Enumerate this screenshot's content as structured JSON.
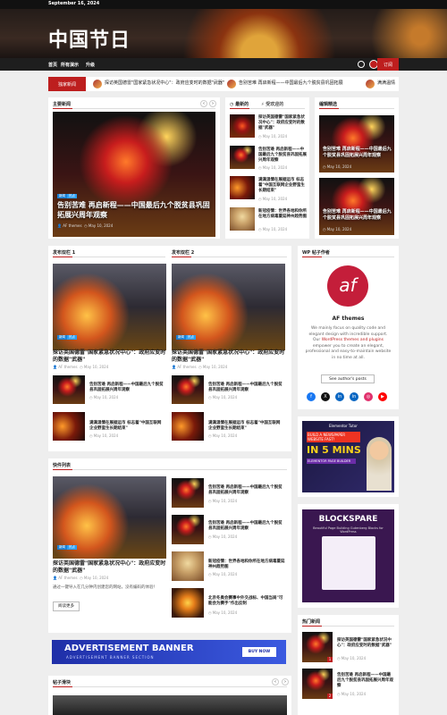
{
  "topbar": {
    "date": "September 16, 2024"
  },
  "site": {
    "title": "中国节日"
  },
  "nav": {
    "items": [
      "首页",
      "所有演示",
      "升级"
    ],
    "subscribe": "订阅"
  },
  "ticker": {
    "label": "独家新闻",
    "items": [
      "探访英国德雷\"国家紧急状况中心\"：政府应变时的数据\"武器\"",
      "告别苦难 再启新程——中国最后九个脱贫县巩固拓展",
      "满满温情"
    ]
  },
  "main_news": {
    "heading": "主要新闻",
    "featured": {
      "tags": [
        "新闻",
        "热点"
      ],
      "title": "告别苦难 再启新程——中国最后九个脱贫县巩固拓展兴周年观察",
      "author": "AF themes",
      "date": "May 10, 2024"
    }
  },
  "tabs_panel": {
    "tabs": [
      "最新的",
      "受欢迎的"
    ],
    "items": [
      {
        "title": "探访英国德雷\"国家紧急状况中心\"：政府应变时的数据\"武器\"",
        "date": "May 10, 2024"
      },
      {
        "title": "告别苦难 再启新程——中国最后九个脱贫县巩固拓展兴周年观察",
        "date": "May 10, 2024"
      },
      {
        "title": "满满温情在展据运市 标志着\"中国互联网企业野蛮生长期结束\"",
        "date": "May 10, 2024"
      },
      {
        "title": "新冠疫情：世界各地和你所在地方病毒蔓延神州趋势图",
        "date": "May 10, 2024"
      }
    ]
  },
  "editors_pick": {
    "heading": "编辑精选",
    "items": [
      {
        "title": "告别苦难 再启新程——中国最后九个脱贫县巩固拓展兴周年观察",
        "date": "May 10, 2024"
      },
      {
        "title": "告别苦难 再启新程——中国最后九个脱贫县巩固拓展兴周年观察",
        "date": "May 10, 2024"
      }
    ]
  },
  "col1": {
    "heading": "发布双栏 1",
    "featured": {
      "tags": [
        "新闻",
        "热点"
      ],
      "title": "探访英国德雷\"国家紧急状况中心\"：政府应变时的数据\"武器\"",
      "author": "AF themes",
      "date": "May 10, 2024"
    },
    "items": [
      {
        "title": "告别苦难 再启新程——中国最后九个脱贫县巩固拓展兴周年观察",
        "date": "May 10, 2024"
      },
      {
        "title": "满满温情在展据运市 标志着\"中国互联网企业野蛮生长期结束\"",
        "date": "May 10, 2024"
      }
    ]
  },
  "col2": {
    "heading": "发布双栏 2",
    "featured": {
      "tags": [
        "新闻",
        "热点"
      ],
      "title": "探访英国德雷\"国家紧急状况中心\"：政府应变时的数据\"武器\"",
      "author": "AF themes",
      "date": "May 10, 2024"
    },
    "items": [
      {
        "title": "告别苦难 再启新程——中国最后九个脱贫县巩固拓展兴周年观察",
        "date": "May 10, 2024"
      },
      {
        "title": "满满温情在展据运市 标志着\"中国互联网企业野蛮生长期结束\"",
        "date": "May 10, 2024"
      }
    ]
  },
  "author_widget": {
    "heading": "WP 帖子作者",
    "name": "AF themes",
    "bio_1": "We mainly focus on quality code and elegant design with incredible support. Our",
    "link": "WordPress themes and plugins",
    "bio_2": "empower you to create an elegant, professional and easy-to-maintain website in no time at all.",
    "button": "See author's posts",
    "social": [
      "f",
      "X",
      "in",
      "in",
      "◎",
      "▶"
    ]
  },
  "promo1": {
    "brand": "Elementor Tutor",
    "line1": "BUILD A NEWSPAPER WEBSITE FAST!",
    "line2": "IN 5 MINS",
    "line3": "ELEMENTOR PAGE BUILDER"
  },
  "promo2": {
    "title": "BLOCKSPARE",
    "sub": "Beautiful Page Building Gutenberg Blocks for WordPress"
  },
  "quick_list": {
    "heading": "快件列表",
    "featured": {
      "tags": [
        "新闻",
        "热点"
      ],
      "title": "探访英国德雷\"国家紧急状况中心\"：政府应变时的数据\"武器\"",
      "author": "AF themes",
      "date": "May 10, 2024",
      "excerpt": "通过一键导入在几分钟内创建您的网站，没有编码的体验！",
      "button": "阅读更多"
    },
    "items": [
      {
        "title": "告别苦难 再启新程——中国最后九个脱贫县巩固拓展兴周年观察",
        "date": "May 10, 2024"
      },
      {
        "title": "告别苦难 再启新程——中国最后九个脱贫县巩固拓展兴周年观察",
        "date": "May 10, 2024"
      },
      {
        "title": "新冠疫情：世界各地和你所在地方病毒蔓延神州趋势图",
        "date": "May 10, 2024"
      },
      {
        "title": "北京冬奥会赛事中外交战标、中国当局\"可能会为赛手\"作出反制",
        "date": "May 10, 2024"
      }
    ]
  },
  "ad": {
    "title": "ADVERTISEMENT BANNER",
    "sub": "ADVERTISEMENT BANNER SECTION",
    "button": "BUY NOW"
  },
  "slider": {
    "heading": "帖子滑块"
  },
  "hot": {
    "heading": "热门新闻",
    "items": [
      {
        "num": "1",
        "title": "探访英国德雷\"国家紧急状况中心\"：政府应变时的数据\"武器\"",
        "date": "May 10, 2024"
      },
      {
        "num": "2",
        "title": "告别苦难 再启新程——中国最后九个脱贫县巩固拓展兴周年观察",
        "date": "May 10, 2024"
      }
    ]
  }
}
